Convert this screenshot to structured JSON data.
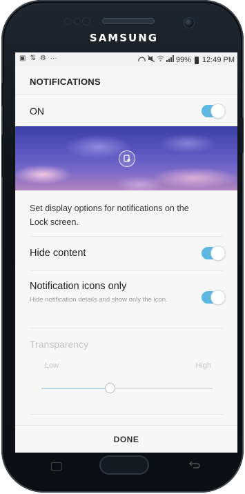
{
  "device": {
    "brand": "SAMSUNG"
  },
  "status_bar": {
    "left_icons": [
      "gallery-notification-icon",
      "sync-icon",
      "settings-notification-icon",
      "more-icon"
    ],
    "left_glyphs": [
      "▣",
      "⇅",
      "⚙",
      "···"
    ],
    "battery": "99%",
    "time": "12:49 PM",
    "right_icons": [
      "headset-icon",
      "mute-icon",
      "wifi-icon",
      "signal-icon",
      "battery-icon"
    ]
  },
  "header": {
    "title": "NOTIFICATIONS"
  },
  "master_switch": {
    "label": "ON",
    "on": true
  },
  "preview": {
    "lock_icon": "lock-screen-icon"
  },
  "description": "Set display options for notifications on the Lock screen.",
  "hide_content": {
    "label": "Hide content",
    "on": true
  },
  "icons_only": {
    "label": "Notification icons only",
    "sublabel": "Hide notification details and show only the icon.",
    "on": true
  },
  "transparency": {
    "label": "Transparency",
    "low_label": "Low",
    "high_label": "High",
    "value_fraction": 0.4
  },
  "footer": {
    "done_label": "DONE"
  },
  "colors": {
    "accent": "#5bb8e0",
    "disabled_text": "#c3c3c3"
  }
}
